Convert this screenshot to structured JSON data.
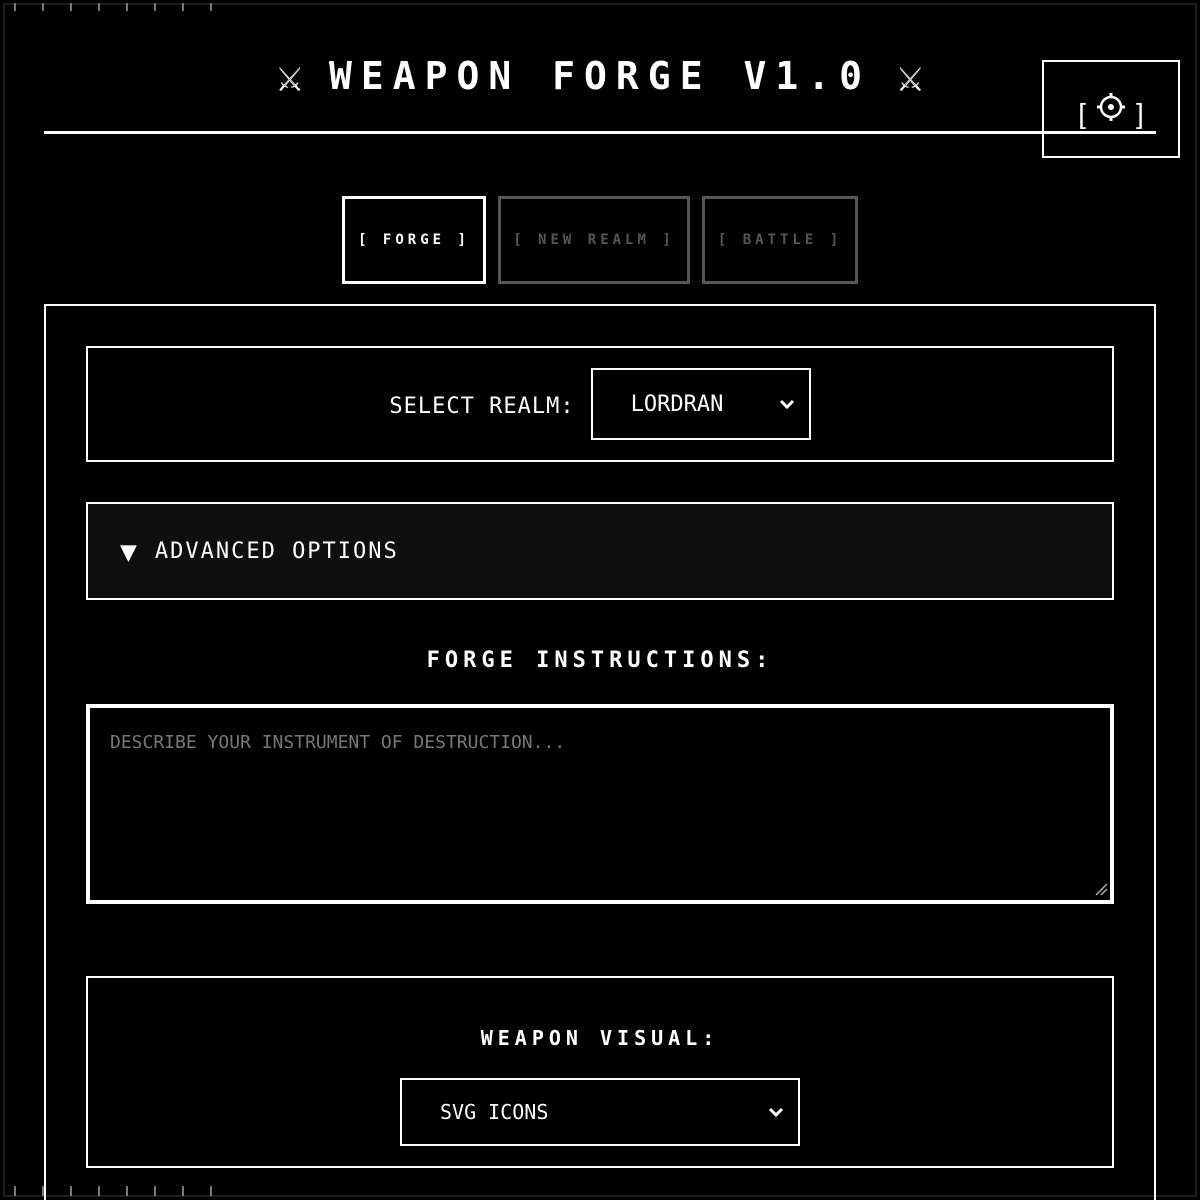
{
  "header": {
    "title": "WEAPON FORGE V1.0",
    "sword_glyph": "⚔",
    "settings": {
      "bracket_left": "[",
      "icon": "gear-icon",
      "bracket_right": "]"
    }
  },
  "tabs": [
    {
      "label": "[ FORGE ]",
      "active": true
    },
    {
      "label": "[ NEW REALM ]",
      "active": false
    },
    {
      "label": "[ BATTLE ]",
      "active": false
    }
  ],
  "realm": {
    "label": "SELECT REALM:",
    "selected": "LORDRAN"
  },
  "advanced": {
    "label": "ADVANCED OPTIONS",
    "expanded": false
  },
  "instructions": {
    "label": "FORGE INSTRUCTIONS:",
    "value": "",
    "placeholder": "DESCRIBE YOUR INSTRUMENT OF DESTRUCTION..."
  },
  "visual": {
    "label": "WEAPON VISUAL:",
    "selected": "SVG ICONS"
  },
  "colors": {
    "background": "#000000",
    "foreground": "#ffffff",
    "inactive": "#555555",
    "placeholder": "#777777"
  }
}
